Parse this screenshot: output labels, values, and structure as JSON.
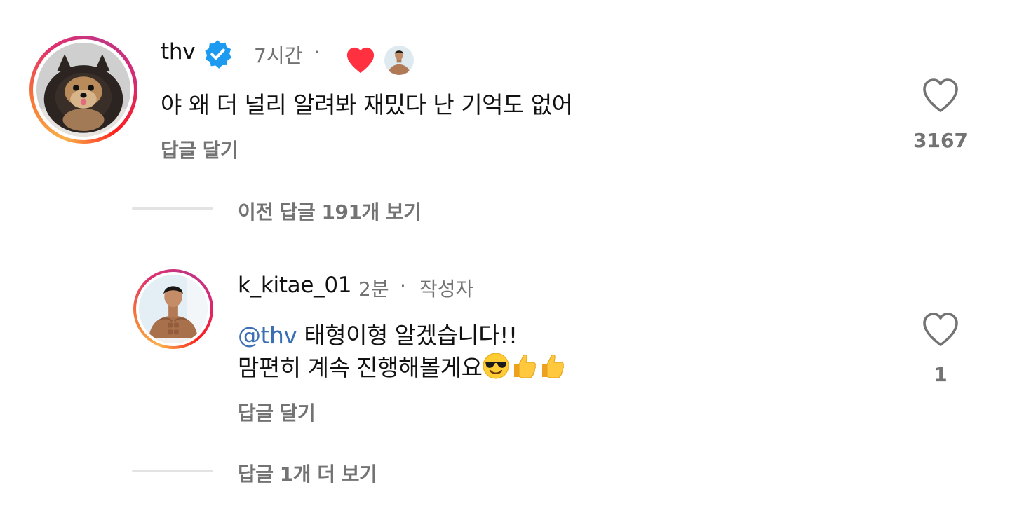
{
  "comments": [
    {
      "username": "thv",
      "verified": true,
      "time": "7시간",
      "separator": "·",
      "text": "야 왜 더 널리 알려봐 재밌다 난 기억도 없어",
      "reply_label": "답글 달기",
      "like_count": "3167",
      "liked_by_author": true,
      "avatar_icon": "pomeranian-dog-avatar"
    },
    {
      "username": "k_kitae_01",
      "time": "2분",
      "separator": "·",
      "author_badge": "작성자",
      "mention": "@thv",
      "text_line1": " 태형이형 알겠습니다!!",
      "text_line2": "맘편히 계속 진행해볼게요",
      "emojis": [
        "smiling-face-with-sunglasses-emoji",
        "thumbs-up-emoji",
        "thumbs-up-emoji"
      ],
      "reply_label": "답글 달기",
      "like_count": "1",
      "avatar_icon": "shirtless-man-avatar"
    }
  ],
  "threads": {
    "view_previous": "이전 답글 191개 보기",
    "view_more": "답글 1개 더 보기"
  },
  "colors": {
    "text": "#111111",
    "secondary": "#737373",
    "mention": "#3a6fb4",
    "verified": "#1d9bf0",
    "heart": "#ff3040",
    "divider": "#e3e3e3"
  }
}
